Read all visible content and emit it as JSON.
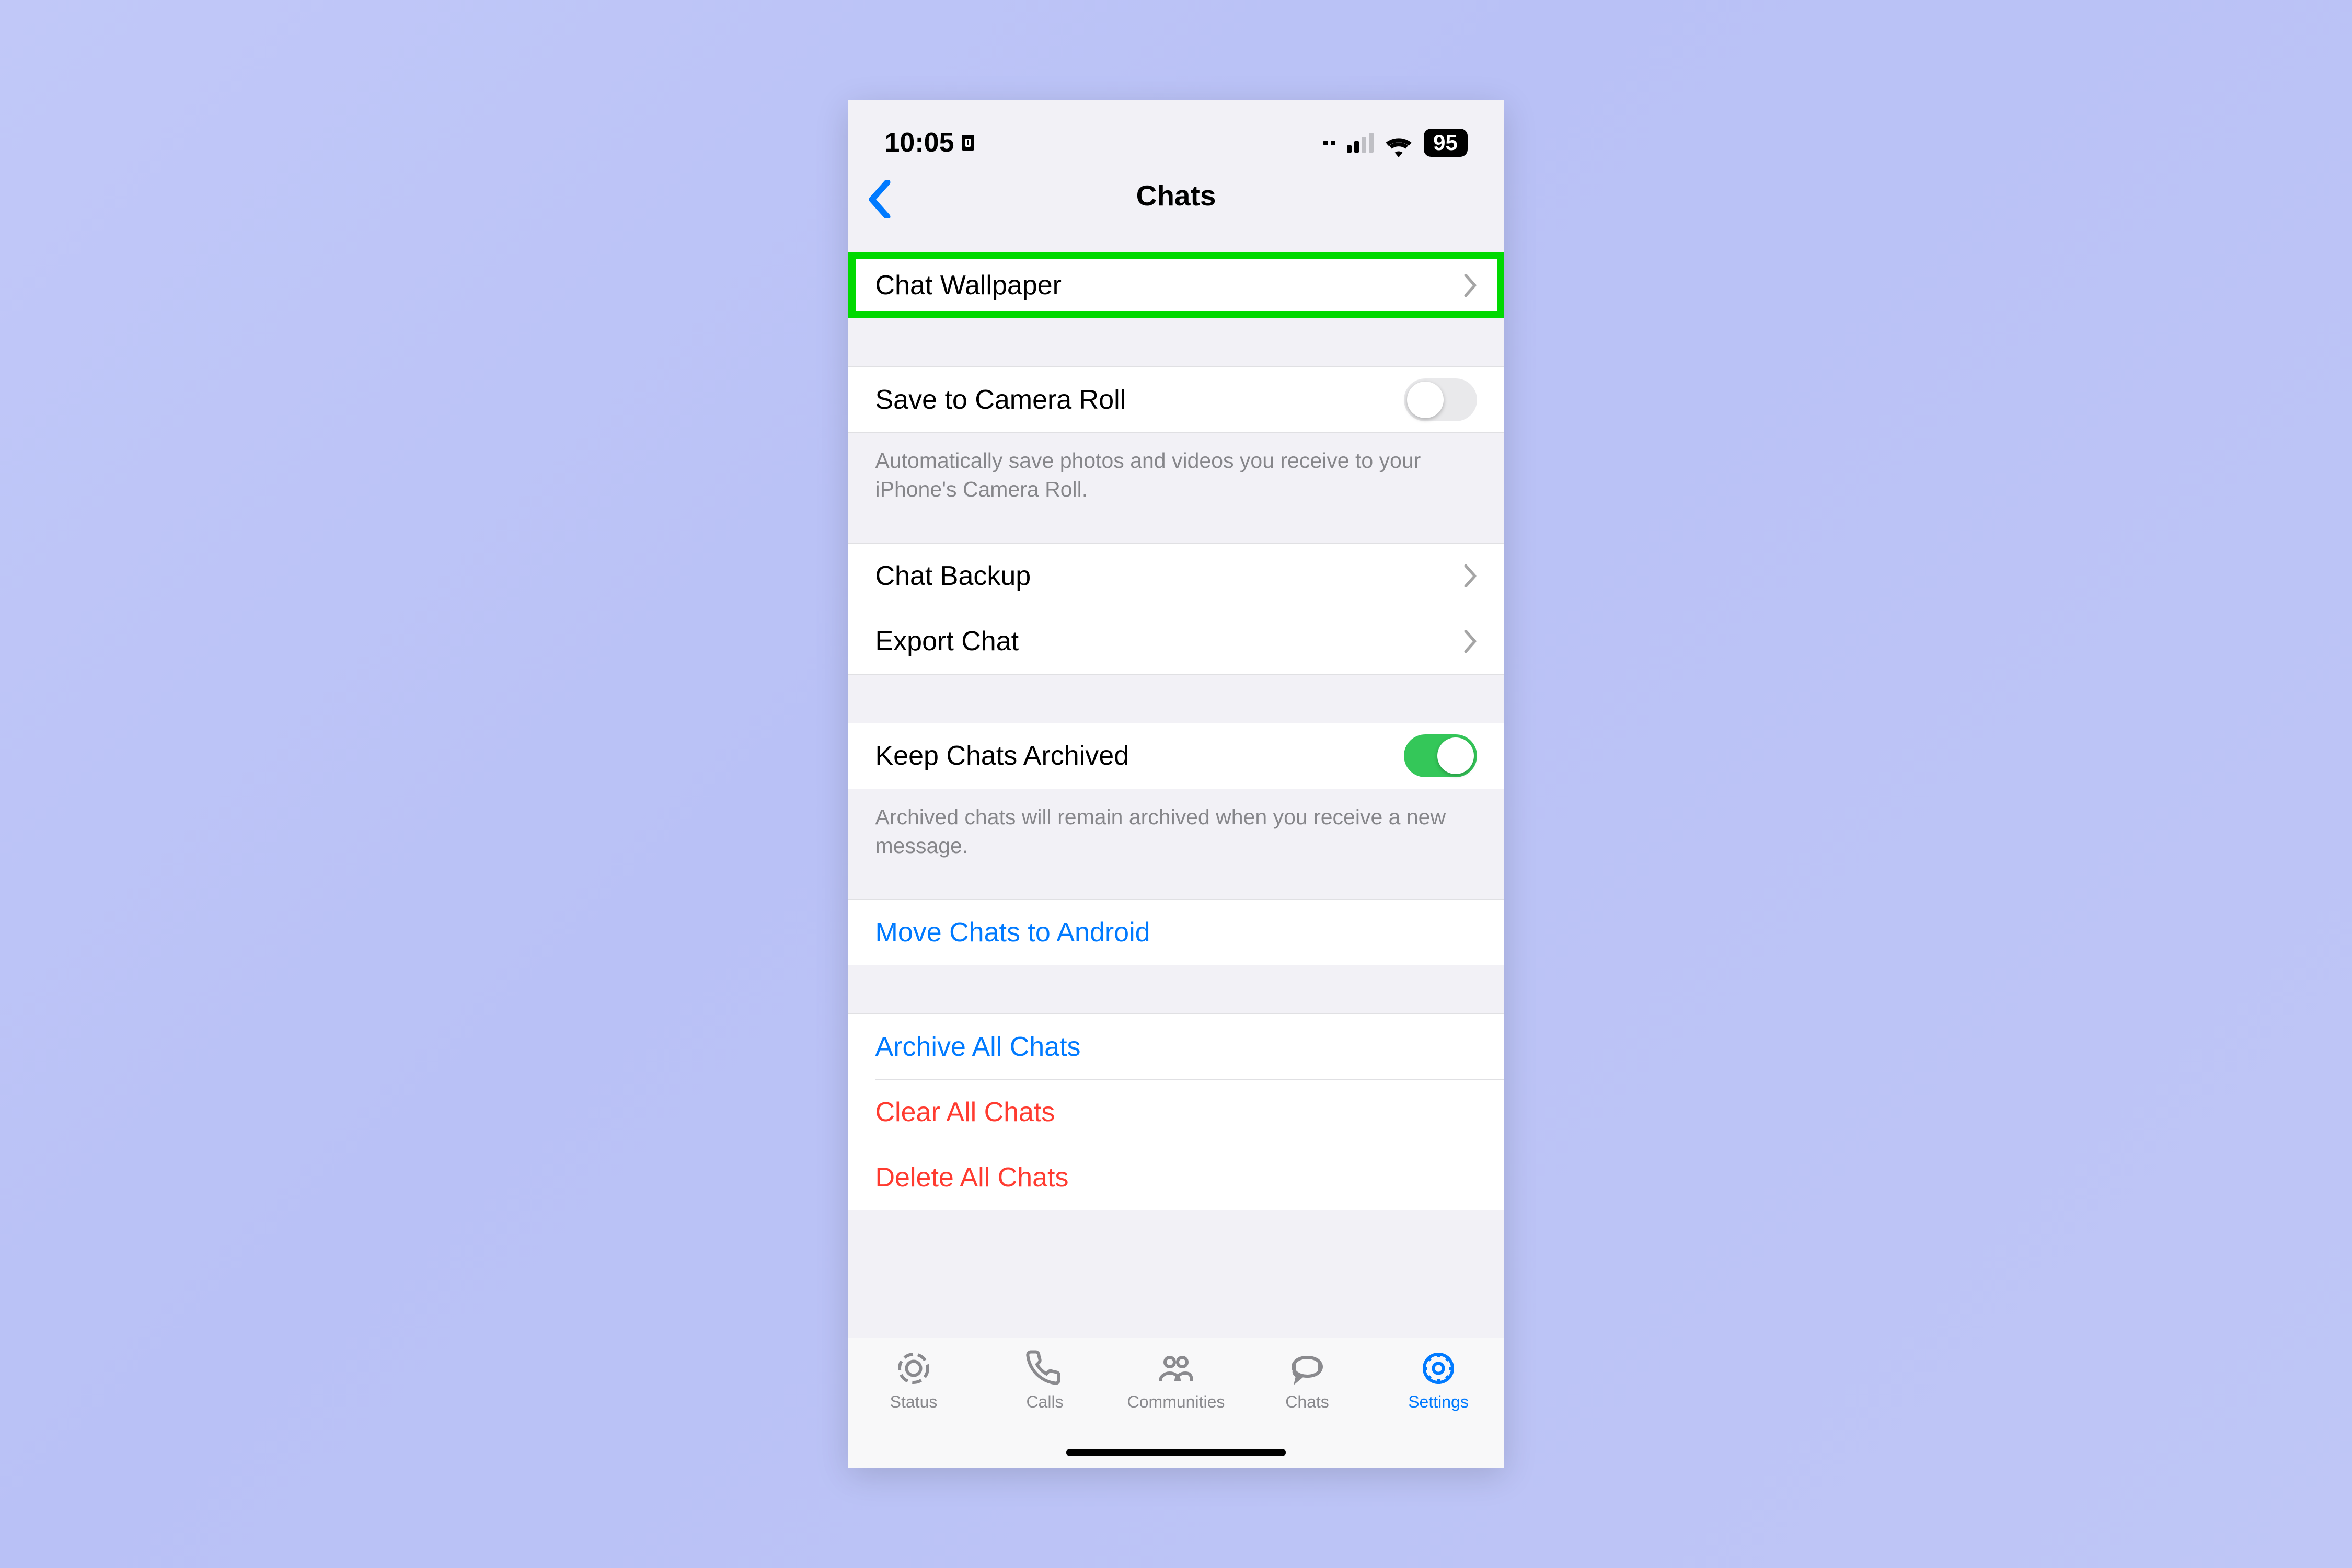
{
  "status_bar": {
    "time": "10:05",
    "battery": "95"
  },
  "header": {
    "title": "Chats"
  },
  "rows": {
    "chat_wallpaper": "Chat Wallpaper",
    "save_camera": "Save to Camera Roll",
    "save_camera_note": "Automatically save photos and videos you receive to your iPhone's Camera Roll.",
    "chat_backup": "Chat Backup",
    "export_chat": "Export Chat",
    "keep_archived": "Keep Chats Archived",
    "keep_archived_note": "Archived chats will remain archived when you receive a new message.",
    "move_android": "Move Chats to Android",
    "archive_all": "Archive All Chats",
    "clear_all": "Clear All Chats",
    "delete_all": "Delete All Chats"
  },
  "toggles": {
    "save_camera": false,
    "keep_archived": true
  },
  "tabs": {
    "status": "Status",
    "calls": "Calls",
    "communities": "Communities",
    "chats": "Chats",
    "settings": "Settings",
    "active": "settings"
  },
  "colors": {
    "accent": "#007aff",
    "danger": "#ff3b30",
    "toggle_on": "#34c759",
    "highlight": "#00d900"
  }
}
